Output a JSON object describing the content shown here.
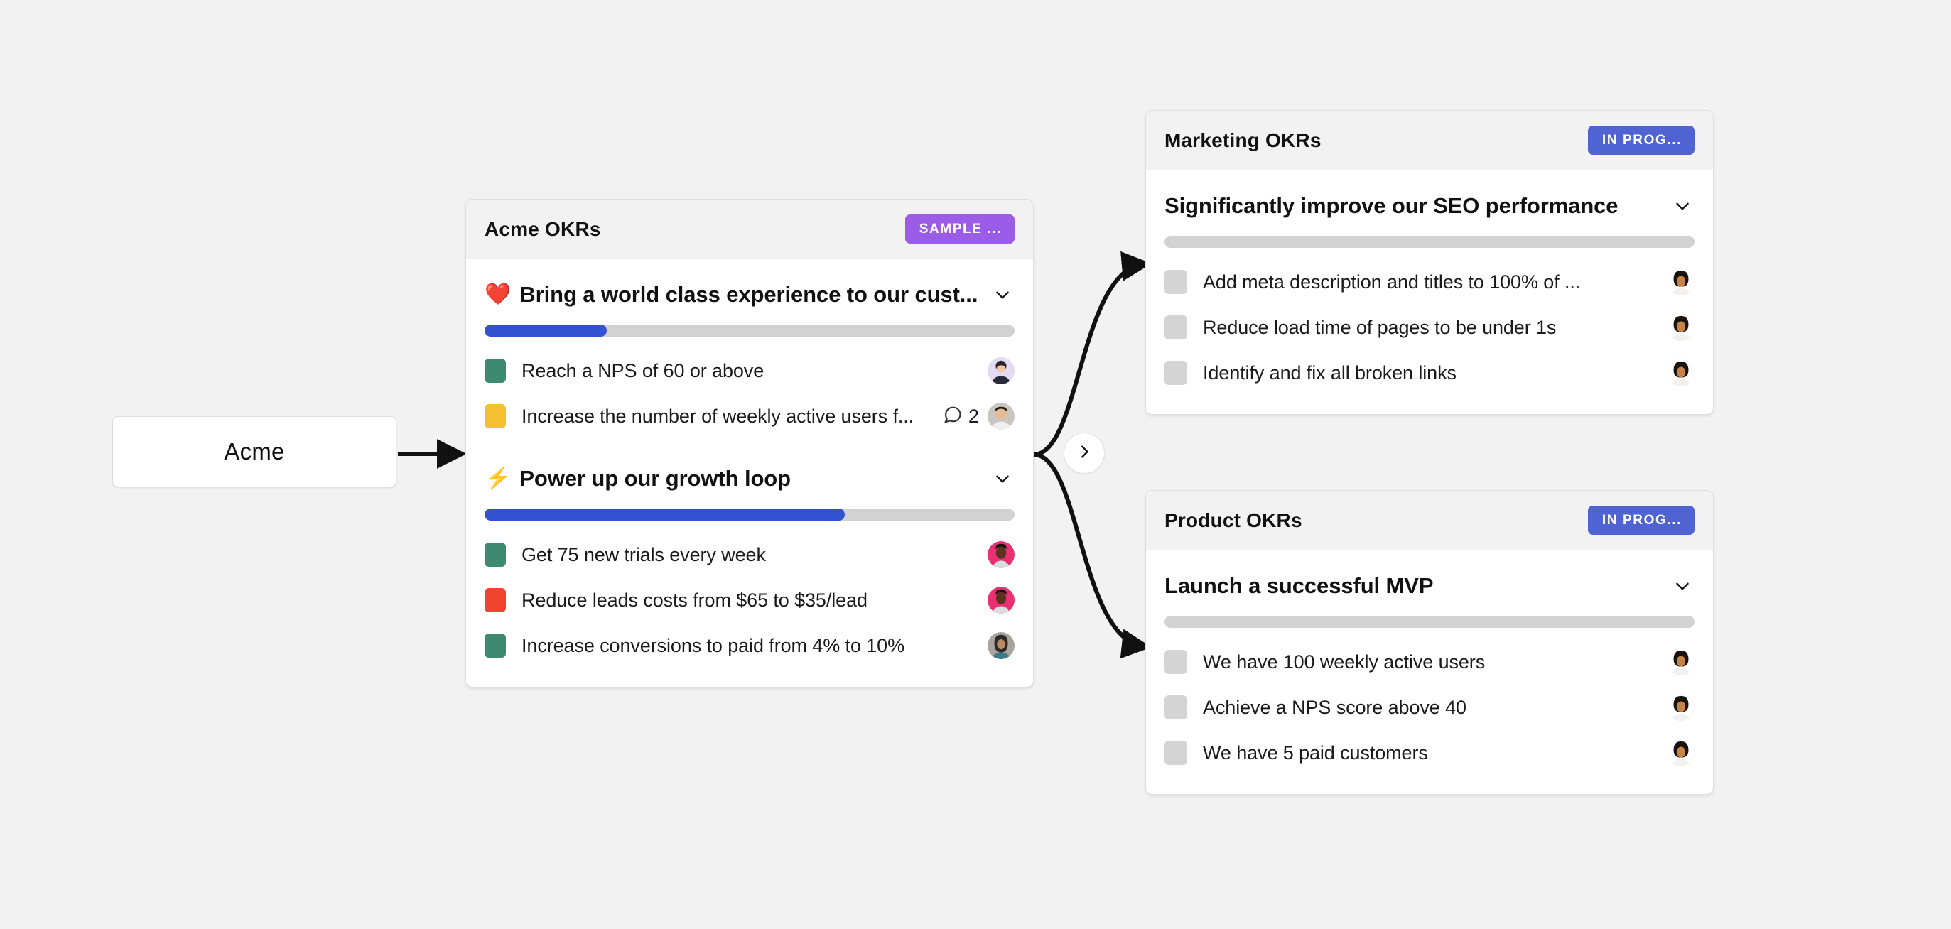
{
  "canvas": {
    "background": "#f2f2f2"
  },
  "root_node": {
    "label": "Acme"
  },
  "toggle": {
    "icon": "chevron-right-icon"
  },
  "colors": {
    "accent_blue": "#3352cf",
    "badge_purple": "#9b5de8",
    "badge_blue": "#4f63d2",
    "swatch_green": "#3d8a70",
    "swatch_yellow": "#f5c131",
    "swatch_red": "#f04431",
    "track_gray": "#d2d2d2",
    "checkbox_gray": "#d4d4d4"
  },
  "cards": [
    {
      "id": "acme-okrs",
      "title": "Acme OKRs",
      "badge": {
        "label": "SAMPLE ...",
        "color": "purple"
      },
      "objectives": [
        {
          "emoji": "❤️",
          "emoji_name": "red-heart-emoji",
          "title": "Bring a world class experience to our cust...",
          "progress_percent": 23,
          "chevron": "chevron-down-icon",
          "key_results": [
            {
              "swatch": "#3d8a70",
              "text": "Reach a NPS of 60 or above",
              "comments": null,
              "avatar": "avatar-woman-dark-hair"
            },
            {
              "swatch": "#f5c131",
              "text": "Increase the number of weekly active users f...",
              "comments": "2",
              "avatar": "avatar-man-smiling"
            }
          ]
        },
        {
          "emoji": "⚡",
          "emoji_name": "high-voltage-emoji",
          "title": "Power up our growth loop",
          "progress_percent": 68,
          "chevron": "chevron-down-icon",
          "key_results": [
            {
              "swatch": "#3d8a70",
              "text": "Get 75 new trials every week",
              "comments": null,
              "avatar": "avatar-woman-pink-bg"
            },
            {
              "swatch": "#f04431",
              "text": "Reduce leads costs from $65 to $35/lead",
              "comments": null,
              "avatar": "avatar-woman-pink-bg"
            },
            {
              "swatch": "#3d8a70",
              "text": "Increase conversions to paid from 4% to 10%",
              "comments": null,
              "avatar": "avatar-person-hijab"
            }
          ]
        }
      ]
    },
    {
      "id": "marketing-okrs",
      "title": "Marketing OKRs",
      "badge": {
        "label": "IN PROG...",
        "color": "blue"
      },
      "objectives": [
        {
          "emoji": "",
          "emoji_name": "",
          "title": "Significantly improve our SEO performance",
          "progress_percent": 0,
          "chevron": "chevron-down-icon",
          "key_results": [
            {
              "checkbox": true,
              "text": "Add meta description and titles to 100% of ...",
              "avatar": "avatar-man-curly-hair"
            },
            {
              "checkbox": true,
              "text": "Reduce load time of pages to be under 1s",
              "avatar": "avatar-man-curly-hair"
            },
            {
              "checkbox": true,
              "text": "Identify and fix all broken links",
              "avatar": "avatar-man-curly-hair"
            }
          ]
        }
      ]
    },
    {
      "id": "product-okrs",
      "title": "Product OKRs",
      "badge": {
        "label": "IN PROG...",
        "color": "blue"
      },
      "objectives": [
        {
          "emoji": "",
          "emoji_name": "",
          "title": "Launch a successful MVP",
          "progress_percent": 0,
          "chevron": "chevron-down-icon",
          "key_results": [
            {
              "checkbox": true,
              "text": "We have 100 weekly active users",
              "avatar": "avatar-man-curly-hair"
            },
            {
              "checkbox": true,
              "text": "Achieve a NPS score above 40",
              "avatar": "avatar-man-curly-hair"
            },
            {
              "checkbox": true,
              "text": "We have 5 paid customers",
              "avatar": "avatar-man-curly-hair"
            }
          ]
        }
      ]
    }
  ]
}
